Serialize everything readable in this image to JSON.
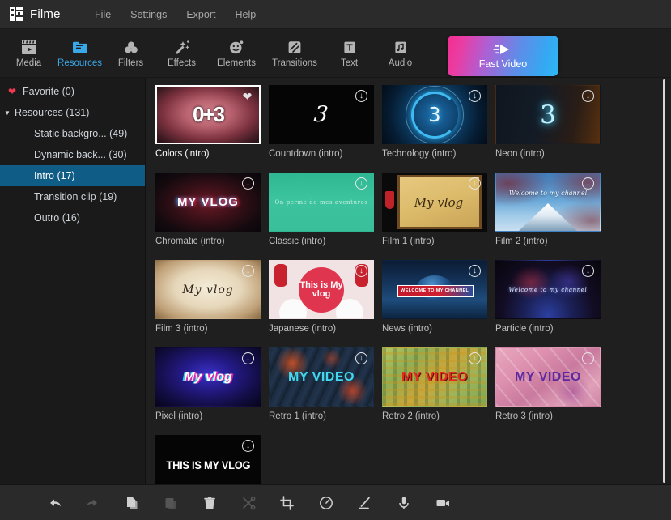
{
  "app": {
    "name": "Filme",
    "logo_icon": "film-clapper-logo-icon"
  },
  "menu": {
    "items": [
      {
        "label": "File",
        "name": "menu-file"
      },
      {
        "label": "Settings",
        "name": "menu-settings"
      },
      {
        "label": "Export",
        "name": "menu-export"
      },
      {
        "label": "Help",
        "name": "menu-help"
      }
    ]
  },
  "toolbar": {
    "tabs": [
      {
        "label": "Media",
        "icon": "clapperboard-icon",
        "active": false
      },
      {
        "label": "Resources",
        "icon": "folder-document-icon",
        "active": true
      },
      {
        "label": "Filters",
        "icon": "color-circles-icon",
        "active": false
      },
      {
        "label": "Effects",
        "icon": "magic-wand-sparkle-icon",
        "active": false
      },
      {
        "label": "Elements",
        "icon": "smiley-face-icon",
        "active": false
      },
      {
        "label": "Transitions",
        "icon": "transition-slash-icon",
        "active": false
      },
      {
        "label": "Text",
        "icon": "text-t-icon",
        "active": false
      },
      {
        "label": "Audio",
        "icon": "music-note-icon",
        "active": false
      }
    ],
    "fast_video": {
      "label": "Fast Video",
      "icon": "fast-forward-arrow-icon",
      "gradient_from": "#f52d8f",
      "gradient_to": "#2fb8f5"
    }
  },
  "sidebar": {
    "items": [
      {
        "label": "Favorite (0)",
        "name": "sidebar-item-favorite",
        "level": 0,
        "icon": "heart-icon",
        "selected": false,
        "expandable": false
      },
      {
        "label": "Resources (131)",
        "name": "sidebar-item-resources",
        "level": 0,
        "icon": "caret-down-icon",
        "selected": false,
        "expandable": true
      },
      {
        "label": "Static backgro... (49)",
        "name": "sidebar-item-static-backgrounds",
        "level": 1,
        "icon": "",
        "selected": false,
        "expandable": false
      },
      {
        "label": "Dynamic back... (30)",
        "name": "sidebar-item-dynamic-backgrounds",
        "level": 1,
        "icon": "",
        "selected": false,
        "expandable": false
      },
      {
        "label": "Intro (17)",
        "name": "sidebar-item-intro",
        "level": 1,
        "icon": "",
        "selected": true,
        "expandable": false
      },
      {
        "label": "Transition clip (19)",
        "name": "sidebar-item-transition-clip",
        "level": 1,
        "icon": "",
        "selected": false,
        "expandable": false
      },
      {
        "label": "Outro (16)",
        "name": "sidebar-item-outro",
        "level": 1,
        "icon": "",
        "selected": false,
        "expandable": false
      }
    ],
    "selection_color": "#0f5d86",
    "heart_color": "#ef3a52"
  },
  "grid": {
    "items": [
      {
        "label": "Colors (intro)",
        "badge": "favorite",
        "selected": true,
        "art": "colors",
        "art_text": "0+3"
      },
      {
        "label": "Countdown (intro)",
        "badge": "download",
        "selected": false,
        "art": "countdown",
        "art_text": "3"
      },
      {
        "label": "Technology (intro)",
        "badge": "download",
        "selected": false,
        "art": "technology",
        "art_text": "3"
      },
      {
        "label": "Neon (intro)",
        "badge": "download",
        "selected": false,
        "art": "neon",
        "art_text": "3"
      },
      {
        "label": "Chromatic (intro)",
        "badge": "download",
        "selected": false,
        "art": "chromatic",
        "art_text": "MY VLOG"
      },
      {
        "label": "Classic (intro)",
        "badge": "download",
        "selected": false,
        "art": "classic",
        "art_text": "On perme de mes aventures"
      },
      {
        "label": "Film 1 (intro)",
        "badge": "download",
        "selected": false,
        "art": "film1",
        "art_text": "My vlog"
      },
      {
        "label": "Film 2 (intro)",
        "badge": "download",
        "selected": false,
        "art": "film2",
        "art_text": "Welcome to my channel"
      },
      {
        "label": "Film 3 (intro)",
        "badge": "download",
        "selected": false,
        "art": "film3",
        "art_text": "My vlog"
      },
      {
        "label": "Japanese (intro)",
        "badge": "download",
        "selected": false,
        "art": "japanese",
        "art_text": "This is My vlog"
      },
      {
        "label": "News (intro)",
        "badge": "download",
        "selected": false,
        "art": "news",
        "art_text": "WELCOME TO MY CHANNEL"
      },
      {
        "label": "Particle (intro)",
        "badge": "download",
        "selected": false,
        "art": "particle",
        "art_text": "Welcome to my channel"
      },
      {
        "label": "Pixel (intro)",
        "badge": "download",
        "selected": false,
        "art": "pixel",
        "art_text": "My vlog"
      },
      {
        "label": "Retro 1 (intro)",
        "badge": "download",
        "selected": false,
        "art": "retro1",
        "art_text": "My Video"
      },
      {
        "label": "Retro 2 (intro)",
        "badge": "download",
        "selected": false,
        "art": "retro2",
        "art_text": "My Video"
      },
      {
        "label": "Retro 3 (intro)",
        "badge": "download",
        "selected": false,
        "art": "retro3",
        "art_text": "My Video"
      },
      {
        "label": "",
        "badge": "download",
        "selected": false,
        "art": "vlogtext",
        "art_text": "THIS IS MY VLOG"
      }
    ]
  },
  "bottombar": {
    "buttons": [
      {
        "name": "undo-button",
        "icon": "undo-arrow-icon",
        "disabled": false
      },
      {
        "name": "redo-button",
        "icon": "redo-arrow-icon",
        "disabled": true
      },
      {
        "name": "copy-button",
        "icon": "copy-pages-icon",
        "disabled": false
      },
      {
        "name": "paste-button",
        "icon": "paste-clipboard-icon",
        "disabled": true
      },
      {
        "name": "delete-button",
        "icon": "trash-bin-icon",
        "disabled": false
      },
      {
        "name": "split-button",
        "icon": "scissors-icon",
        "disabled": true
      },
      {
        "name": "crop-button",
        "icon": "crop-frame-icon",
        "disabled": false
      },
      {
        "name": "speed-button",
        "icon": "speedometer-icon",
        "disabled": false
      },
      {
        "name": "color-edit-button",
        "icon": "pencil-line-icon",
        "disabled": false
      },
      {
        "name": "voiceover-button",
        "icon": "microphone-icon",
        "disabled": false
      },
      {
        "name": "record-button",
        "icon": "video-camera-icon",
        "disabled": false
      }
    ]
  }
}
